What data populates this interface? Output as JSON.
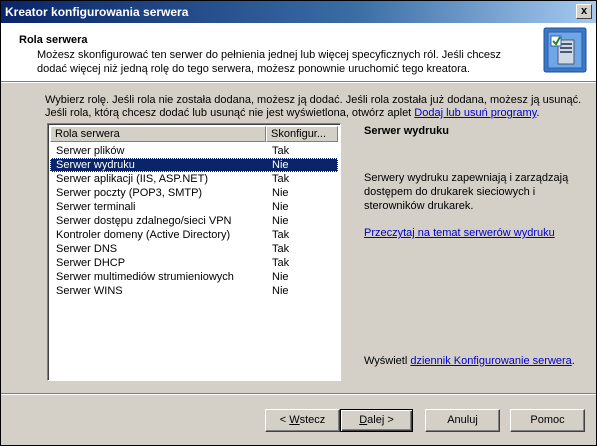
{
  "window": {
    "title": "Kreator konfigurowania serwera",
    "close_glyph": "x"
  },
  "header": {
    "title": "Rola serwera",
    "description": "Możesz skonfigurować ten serwer do pełnienia jednej lub więcej specyficznych ról. Jeśli chcesz dodać więcej niż jedną rolę do tego serwera, możesz ponownie uruchomić tego kreatora.",
    "icon": "server-configuration-icon"
  },
  "instructions": {
    "text": "Wybierz rolę. Jeśli rola nie została dodana, możesz ją dodać. Jeśli rola została już dodana, możesz ją usunąć. Jeśli rola, którą chcesz dodać lub usunąć nie jest wyświetlona, otwórz aplet ",
    "link": "Dodaj lub usuń programy",
    "suffix": "."
  },
  "list": {
    "columns": {
      "role": "Rola serwera",
      "configured": "Skonfigur..."
    },
    "rows": [
      {
        "role": "Serwer plików",
        "configured": "Tak"
      },
      {
        "role": "Serwer wydruku",
        "configured": "Nie"
      },
      {
        "role": "Serwer aplikacji (IIS, ASP.NET)",
        "configured": "Tak"
      },
      {
        "role": "Serwer poczty (POP3, SMTP)",
        "configured": "Nie"
      },
      {
        "role": "Serwer terminali",
        "configured": "Nie"
      },
      {
        "role": "Serwer dostępu zdalnego/sieci VPN",
        "configured": "Nie"
      },
      {
        "role": "Kontroler domeny (Active Directory)",
        "configured": "Tak"
      },
      {
        "role": "Serwer DNS",
        "configured": "Tak"
      },
      {
        "role": "Serwer DHCP",
        "configured": "Tak"
      },
      {
        "role": "Serwer multimediów strumieniowych",
        "configured": "Nie"
      },
      {
        "role": "Serwer WINS",
        "configured": "Nie"
      }
    ],
    "selected_index": 1
  },
  "details": {
    "title": "Serwer wydruku",
    "description": "Serwery wydruku zapewniają i zarządzają dostępem do drukarek sieciowych i sterowników drukarek.",
    "link": "Przeczytaj na temat serwerów wydruku",
    "log_prefix": "Wyświetl ",
    "log_link": "dziennik Konfigurowanie serwera",
    "log_suffix": "."
  },
  "buttons": {
    "back": {
      "pre": "< ",
      "key": "W",
      "post": "stecz"
    },
    "next": {
      "key": "D",
      "post": "alej >"
    },
    "cancel": "Anuluj",
    "help": "Pomoc"
  },
  "colors": {
    "title_start": "#0a246a",
    "title_end": "#a6caf0",
    "selection": "#0a246a",
    "link": "#0000cc"
  }
}
